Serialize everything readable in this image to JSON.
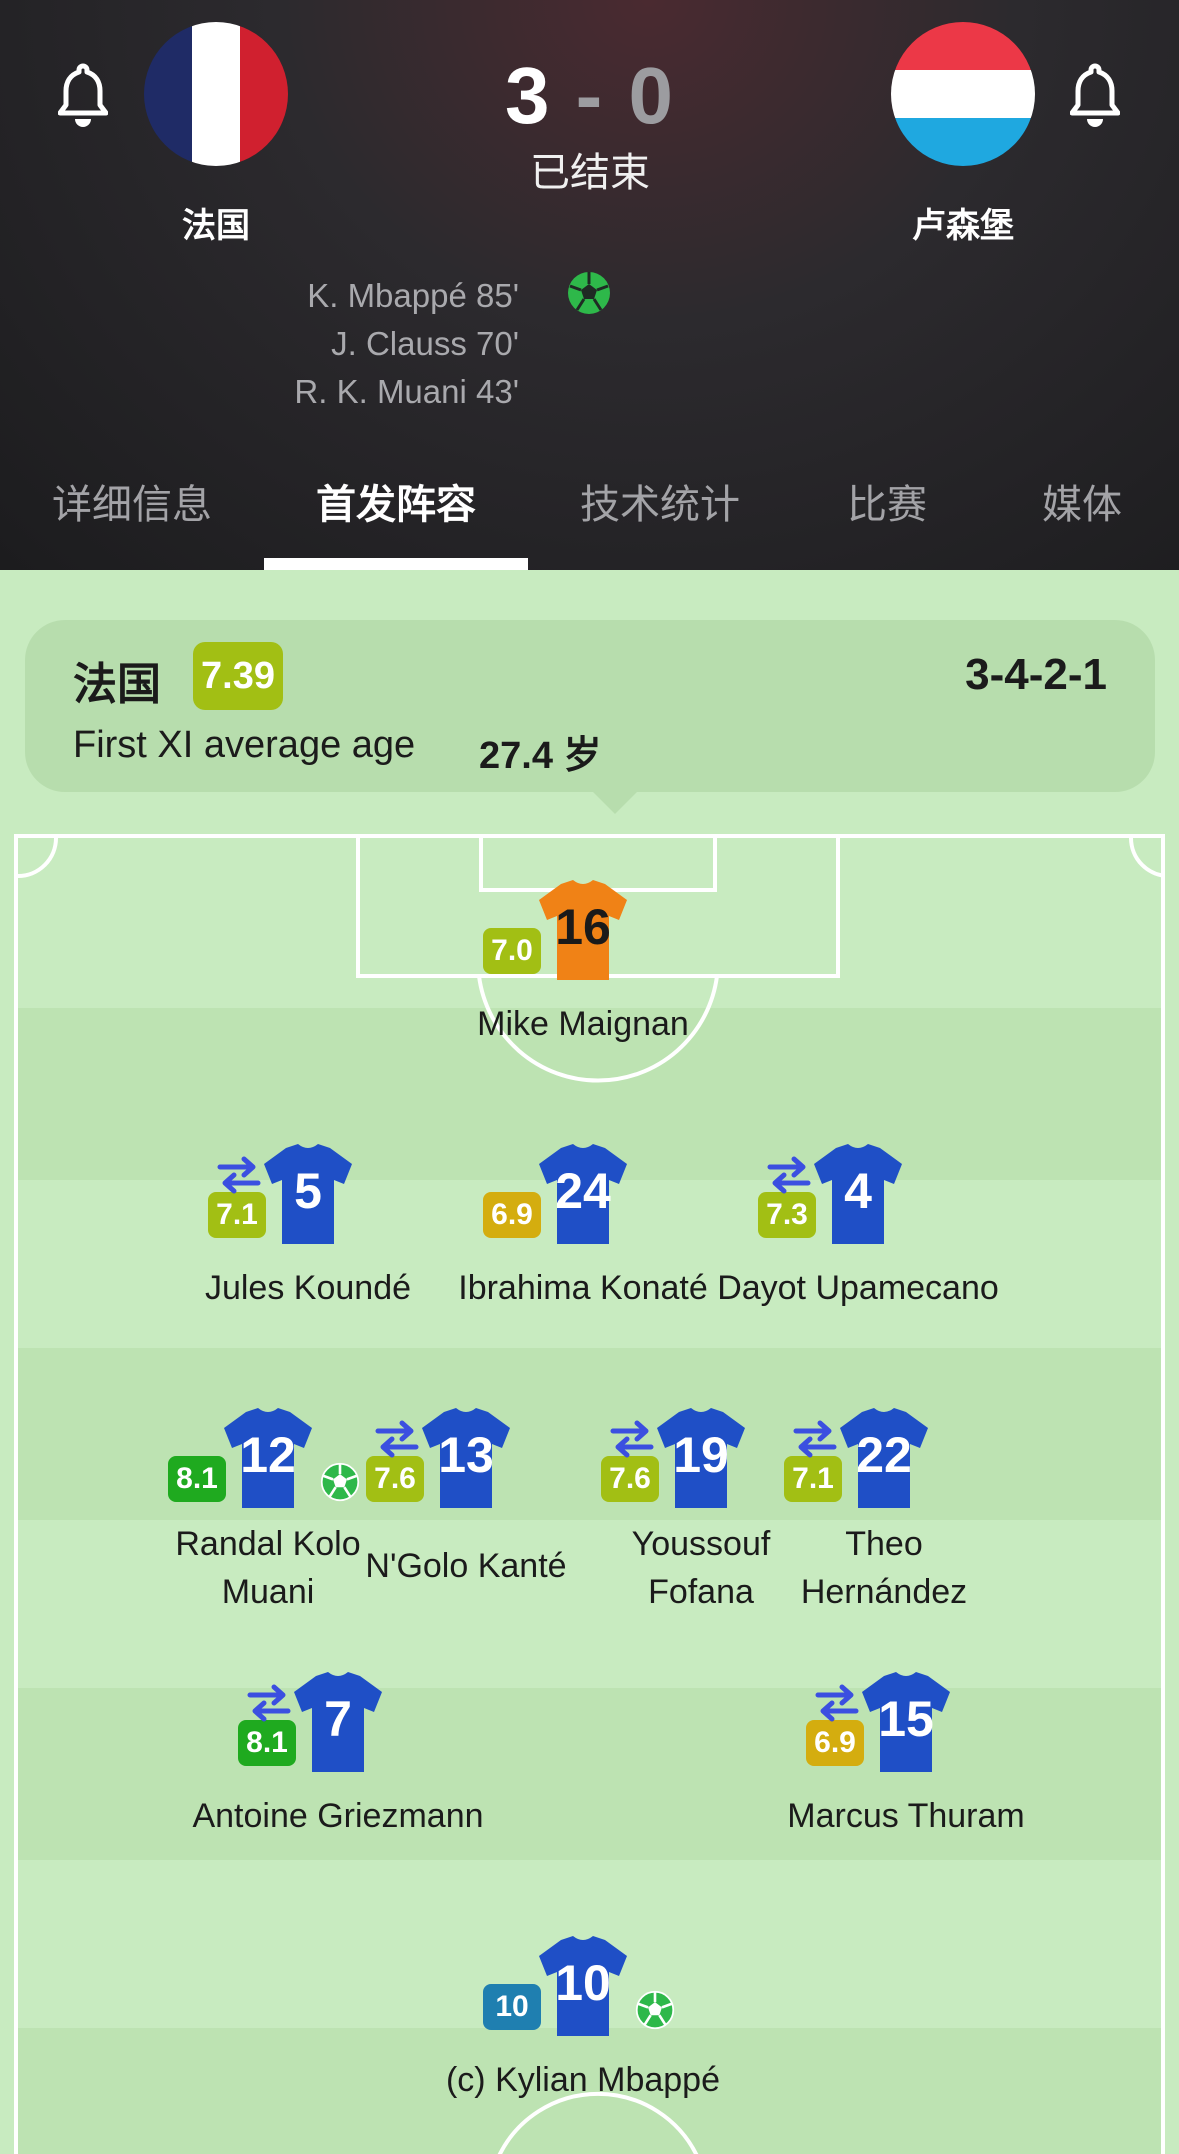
{
  "match": {
    "home": {
      "name": "法国",
      "score": "3"
    },
    "away": {
      "name": "卢森堡",
      "score": "0"
    },
    "separator": "-",
    "status": "已结束",
    "scorers": [
      "K. Mbappé 85'",
      "J. Clauss 70'",
      "R. K. Muani 43'"
    ]
  },
  "tabs": [
    {
      "label": "详细信息"
    },
    {
      "label": "首发阵容",
      "active": true
    },
    {
      "label": "技术统计"
    },
    {
      "label": "比赛"
    },
    {
      "label": "媒体"
    }
  ],
  "team_card": {
    "name": "法国",
    "rating": "7.39",
    "formation": "3-4-2-1",
    "age_label": "First XI average age",
    "age_value": "27.4 岁"
  },
  "colors": {
    "rating_green_dark": "#1faa1f",
    "rating_green": "#a2bf14",
    "rating_yellow": "#d4ad0f",
    "rating_blue": "#1f7fb0",
    "shirt_blue": "#1f4fc6",
    "shirt_gk": "#f08216",
    "sub_icon": "#3b4fe0"
  },
  "players": [
    {
      "number": "16",
      "name": "Mike Maignan",
      "rating": "7.0",
      "rating_color": "#a2bf14",
      "sub": false,
      "goal": false,
      "goalkeeper": true
    },
    {
      "number": "5",
      "name": "Jules Koundé",
      "rating": "7.1",
      "rating_color": "#a2bf14",
      "sub": true,
      "goal": false
    },
    {
      "number": "24",
      "name": "Ibrahima Konaté",
      "rating": "6.9",
      "rating_color": "#d4ad0f",
      "sub": false,
      "goal": false
    },
    {
      "number": "4",
      "name": "Dayot Upamecano",
      "rating": "7.3",
      "rating_color": "#a2bf14",
      "sub": true,
      "goal": false
    },
    {
      "number": "12",
      "name": "Randal Kolo Muani",
      "name_lines": [
        "Randal Kolo",
        "Muani"
      ],
      "rating": "8.1",
      "rating_color": "#1faa1f",
      "sub": false,
      "goal": true
    },
    {
      "number": "13",
      "name": "N'Golo Kanté",
      "rating": "7.6",
      "rating_color": "#a2bf14",
      "sub": true,
      "goal": false
    },
    {
      "number": "19",
      "name": "Youssouf Fofana",
      "name_lines": [
        "Youssouf",
        "Fofana"
      ],
      "rating": "7.6",
      "rating_color": "#a2bf14",
      "sub": true,
      "goal": false
    },
    {
      "number": "22",
      "name": "Theo Hernández",
      "name_lines": [
        "Theo",
        "Hernández"
      ],
      "rating": "7.1",
      "rating_color": "#a2bf14",
      "sub": true,
      "goal": false
    },
    {
      "number": "7",
      "name": "Antoine Griezmann",
      "rating": "8.1",
      "rating_color": "#1faa1f",
      "sub": true,
      "goal": false
    },
    {
      "number": "15",
      "name": "Marcus Thuram",
      "rating": "6.9",
      "rating_color": "#d4ad0f",
      "sub": true,
      "goal": false
    },
    {
      "number": "10",
      "name": "(c) Kylian Mbappé",
      "rating": "10",
      "rating_color": "#1f7fb0",
      "sub": false,
      "goal": true
    }
  ]
}
